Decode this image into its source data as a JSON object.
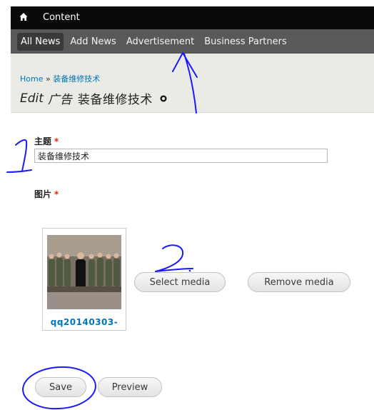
{
  "toolbar": {
    "home_icon": "home-icon",
    "content_label": "Content"
  },
  "tabs": [
    {
      "label": "All News",
      "active": true
    },
    {
      "label": "Add News",
      "active": false
    },
    {
      "label": "Advertisement",
      "active": false
    },
    {
      "label": "Business Partners",
      "active": false
    }
  ],
  "breadcrumb": {
    "home": "Home",
    "separator": "»",
    "current": "装备维修技术"
  },
  "page_title": {
    "edit": "Edit",
    "type": "广告",
    "title": "装备维修技术",
    "shortcut_icon": "plus-circle-icon"
  },
  "form": {
    "title_label": "主题",
    "title_value": "装备维修技术",
    "image_label": "图片",
    "required_marker": "*",
    "media_filename": "qq20140303-",
    "select_media_label": "Select media",
    "remove_media_label": "Remove media",
    "save_label": "Save",
    "preview_label": "Preview"
  },
  "annotations": {
    "mark_1": "1",
    "mark_2": "2.",
    "color": "#1a1aff"
  },
  "colors": {
    "toolbar_bg": "#0a0a0a",
    "tabs_bg": "#595959",
    "header_bg": "#ebebe6",
    "link": "#0074bd",
    "required": "#e32700"
  }
}
